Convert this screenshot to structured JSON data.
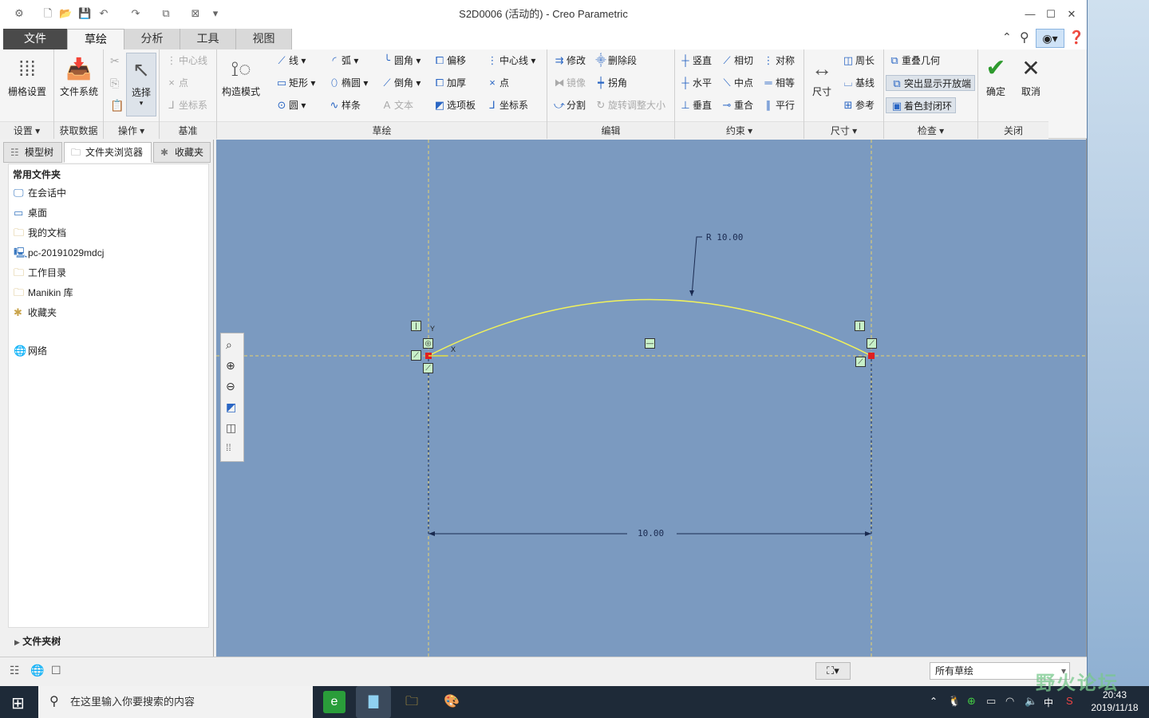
{
  "window": {
    "title": "S2D0006 (活动的) - Creo Parametric"
  },
  "tabs": [
    "文件",
    "草绘",
    "分析",
    "工具",
    "视图"
  ],
  "ribbon": {
    "setup": {
      "big": "栅格设置",
      "label": "设置"
    },
    "get_data": {
      "big": "文件系统",
      "label": "获取数据"
    },
    "operations": {
      "big": "选择",
      "label": "操作"
    },
    "datum": {
      "items": [
        "中心线",
        "点",
        "坐标系"
      ],
      "label": "基准"
    },
    "construction": {
      "big": "构造模式"
    },
    "sketch": {
      "col1": [
        "线",
        "矩形",
        "圆"
      ],
      "col2": [
        "弧",
        "椭圆",
        "样条"
      ],
      "col3": [
        "圆角",
        "倒角",
        "文本"
      ],
      "col4": [
        "偏移",
        "加厚",
        "选项板"
      ],
      "col5": [
        "中心线",
        "点",
        "坐标系"
      ],
      "label": "草绘"
    },
    "edit": {
      "col1": [
        "修改",
        "镜像",
        "分割"
      ],
      "col2": [
        "删除段",
        "拐角",
        "旋转调整大小"
      ],
      "label": "编辑"
    },
    "constrain": {
      "col1": [
        "竖直",
        "水平",
        "垂直"
      ],
      "col2": [
        "相切",
        "中点",
        "重合"
      ],
      "col3": [
        "对称",
        "相等",
        "平行"
      ],
      "label": "约束"
    },
    "dimension": {
      "big": "尺寸",
      "items": [
        "周长",
        "基线",
        "参考"
      ],
      "label": "尺寸"
    },
    "inspect": {
      "items": [
        "重叠几何",
        "突出显示开放端",
        "着色封闭环"
      ],
      "label": "检查"
    },
    "close": {
      "ok": "确定",
      "cancel": "取消",
      "label": "关闭"
    }
  },
  "panel": {
    "tabs": [
      "模型树",
      "文件夹浏览器",
      "收藏夹"
    ],
    "header": "常用文件夹",
    "folders": [
      "在会话中",
      "桌面",
      "我的文档",
      "pc-20191029mdcj",
      "工作目录",
      "Manikin 库",
      "收藏夹"
    ],
    "network": "网络",
    "tree": "文件夹树"
  },
  "sketch": {
    "radius_label": "R 10.00",
    "length_label": "10.00",
    "axis_x": "X",
    "axis_y": "Y"
  },
  "status": {
    "filter": "所有草绘"
  },
  "taskbar": {
    "search_placeholder": "在这里输入你要搜索的内容",
    "time": "20:43",
    "date": "2019/11/18",
    "ime": "中"
  },
  "watermark": "野火论坛"
}
